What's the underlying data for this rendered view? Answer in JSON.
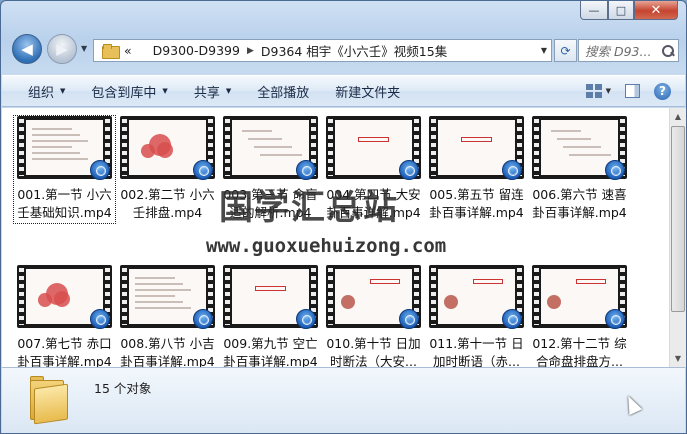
{
  "window": {
    "caption": {
      "minimize": "—",
      "maximize": "□",
      "close": "✕"
    }
  },
  "address": {
    "prefix": "«",
    "crumbs": [
      "D9300-D9399",
      "D9364 相宇《小六壬》视频15集"
    ],
    "separator": "▶"
  },
  "search": {
    "placeholder": "搜索 D93..."
  },
  "toolbar": {
    "items": [
      {
        "label": "组织",
        "dropdown": true
      },
      {
        "label": "包含到库中",
        "dropdown": true
      },
      {
        "label": "共享",
        "dropdown": true
      },
      {
        "label": "全部播放",
        "dropdown": false
      },
      {
        "label": "新建文件夹",
        "dropdown": false
      }
    ]
  },
  "files": [
    {
      "line1": "001.第一节 小六",
      "line2": "壬基础知识.mp4",
      "selected": true
    },
    {
      "line1": "002.第二节 小六",
      "line2": "壬排盘.mp4",
      "selected": false
    },
    {
      "line1": "003.第三节 命盲",
      "line2": "适的解析.mp4",
      "selected": false
    },
    {
      "line1": "004.第四节 大安",
      "line2": "卦百事详解.mp4",
      "selected": false
    },
    {
      "line1": "005.第五节 留连",
      "line2": "卦百事详解.mp4",
      "selected": false
    },
    {
      "line1": "006.第六节 速喜",
      "line2": "卦百事详解.mp4",
      "selected": false
    },
    {
      "line1": "007.第七节 赤口",
      "line2": "卦百事详解.mp4",
      "selected": false
    },
    {
      "line1": "008.第八节 小吉",
      "line2": "卦百事详解.mp4",
      "selected": false
    },
    {
      "line1": "009.第九节 空亡",
      "line2": "卦百事详解.mp4",
      "selected": false
    },
    {
      "line1": "010.第十节 日加",
      "line2": "时断法（大安...",
      "selected": false
    },
    {
      "line1": "011.第十一节 日",
      "line2": "加时断语（赤...",
      "selected": false
    },
    {
      "line1": "012.第十二节 综",
      "line2": "合命盘排盘方...",
      "selected": false
    }
  ],
  "watermark": {
    "text": "国学汇总站",
    "url": "www.guoxuehuizong.com"
  },
  "details": {
    "count": "15 个对象"
  }
}
